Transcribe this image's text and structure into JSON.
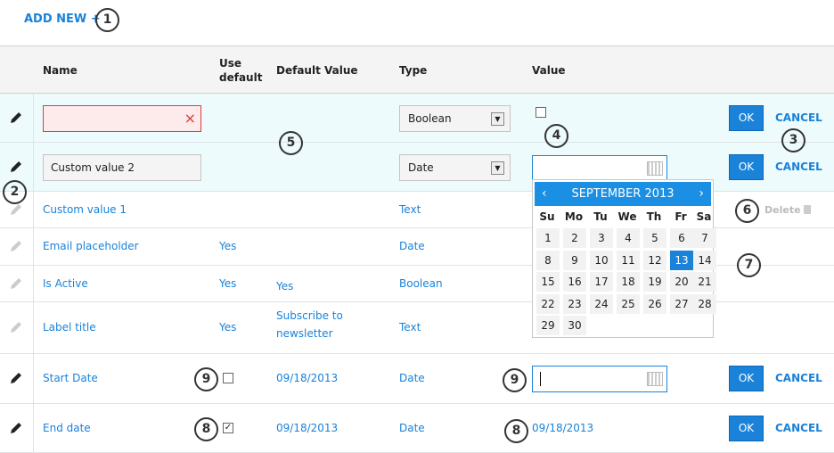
{
  "add_new": "ADD NEW +",
  "headers": {
    "name": "Name",
    "use_default": "Use default",
    "default_value": "Default Value",
    "type": "Type",
    "value": "Value"
  },
  "rows": [
    {
      "name": "",
      "type": "Boolean",
      "editing": true
    },
    {
      "name": "Custom value 2",
      "type": "Date",
      "editing": true
    },
    {
      "name": "Custom value 1",
      "use_default": "",
      "default_value": "",
      "type": "Text"
    },
    {
      "name": "Email placeholder",
      "use_default": "Yes",
      "default_value": "",
      "type": "Date"
    },
    {
      "name": "Is Active",
      "use_default": "Yes",
      "default_value": "Yes",
      "type": "Boolean"
    },
    {
      "name": "Label title",
      "use_default": "Yes",
      "default_value": "Subscribe to newsletter",
      "type": "Text"
    },
    {
      "name": "Start Date",
      "use_default_checked": false,
      "default_value": "09/18/2013",
      "type": "Date",
      "value": ""
    },
    {
      "name": "End date",
      "use_default_checked": true,
      "default_value": "09/18/2013",
      "type": "Date",
      "value": "09/18/2013"
    }
  ],
  "ok_label": "OK",
  "cancel_label": "CANCEL",
  "delete_label": "Delete",
  "clear_icon": "×",
  "check_mark": "✓",
  "select_arrow": "▼",
  "calendar": {
    "title": "SEPTEMBER 2013",
    "prev": "‹",
    "next": "›",
    "days": [
      "Su",
      "Mo",
      "Tu",
      "We",
      "Th",
      "Fr",
      "Sa"
    ],
    "first_weekday": 0,
    "num_days": 30,
    "selected": 13
  },
  "badges": [
    "1",
    "2",
    "3",
    "4",
    "5",
    "6",
    "7",
    "8",
    "9"
  ],
  "accent": "#1a82d9"
}
